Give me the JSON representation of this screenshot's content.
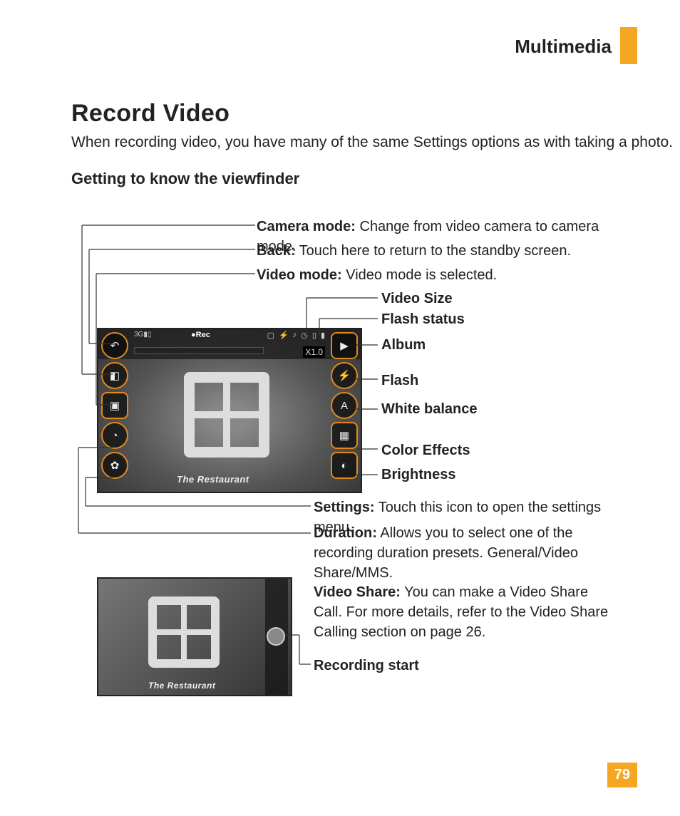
{
  "header": {
    "section": "Multimedia"
  },
  "h1": "Record Video",
  "intro": "When recording video, you have many of the same Settings options as with taking a photo.",
  "h2": "Getting to know the viewfinder",
  "labels": {
    "camera_b": "Camera mode:",
    "camera_t": " Change from video camera to camera mode.",
    "back_b": "Back:",
    "back_t": " Touch here to return to the standby screen.",
    "video_b": "Video mode:",
    "video_t": " Video mode is selected.",
    "size": "Video Size",
    "flash_status": "Flash status",
    "album": "Album",
    "flash": "Flash",
    "wb": "White balance",
    "color": "Color Effects",
    "bright": "Brightness",
    "settings_b": "Settings:",
    "settings_t": " Touch this icon to open the settings menu.",
    "duration_b": "Duration:",
    "duration_t": " Allows you to select one of the recording duration presets. General/Video Share/MMS.",
    "vshare_b": "Video Share:",
    "vshare_t": " You can make a Video Share Call. For more details, refer to the Video Share Calling section on page 26.",
    "recstart": "Recording start"
  },
  "viewfinder": {
    "zoom": "X1.0",
    "rec_indicator": "●Rec",
    "signal": "3G▮▯",
    "caption": "The Restaurant"
  },
  "page": "79"
}
